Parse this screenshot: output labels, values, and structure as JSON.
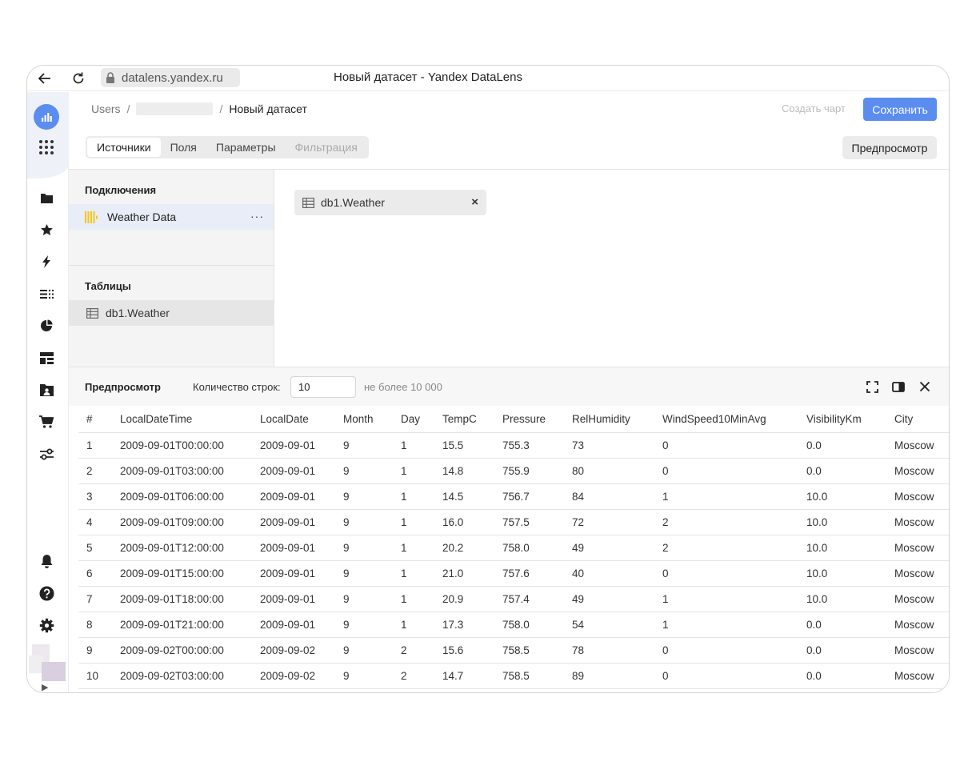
{
  "browser": {
    "url": "datalens.yandex.ru",
    "tab_title": "Новый датасет - Yandex DataLens"
  },
  "breadcrumb": {
    "root": "Users",
    "separator": "/",
    "current": "Новый датасет"
  },
  "header": {
    "create_chart_label": "Создать чарт",
    "save_label": "Сохранить",
    "preview_label": "Предпросмотр"
  },
  "tabs": [
    {
      "label": "Источники",
      "active": true
    },
    {
      "label": "Поля"
    },
    {
      "label": "Параметры"
    },
    {
      "label": "Фильтрация",
      "disabled": true
    }
  ],
  "sources": {
    "connections_title": "Подключения",
    "connection_name": "Weather Data",
    "more_label": "···",
    "tables_title": "Таблицы",
    "table_name": "db1.Weather"
  },
  "workspace": {
    "chip_label": "db1.Weather",
    "close_label": "×"
  },
  "preview": {
    "title": "Предпросмотр",
    "rows_label": "Количество строк:",
    "rows_value": "10",
    "rows_hint": "не более 10 000",
    "columns": [
      "#",
      "LocalDateTime",
      "LocalDate",
      "Month",
      "Day",
      "TempC",
      "Pressure",
      "RelHumidity",
      "WindSpeed10MinAvg",
      "VisibilityKm",
      "City"
    ],
    "rows": [
      [
        "1",
        "2009-09-01T00:00:00",
        "2009-09-01",
        "9",
        "1",
        "15.5",
        "755.3",
        "73",
        "0",
        "0.0",
        "Moscow"
      ],
      [
        "2",
        "2009-09-01T03:00:00",
        "2009-09-01",
        "9",
        "1",
        "14.8",
        "755.9",
        "80",
        "0",
        "0.0",
        "Moscow"
      ],
      [
        "3",
        "2009-09-01T06:00:00",
        "2009-09-01",
        "9",
        "1",
        "14.5",
        "756.7",
        "84",
        "1",
        "10.0",
        "Moscow"
      ],
      [
        "4",
        "2009-09-01T09:00:00",
        "2009-09-01",
        "9",
        "1",
        "16.0",
        "757.5",
        "72",
        "2",
        "10.0",
        "Moscow"
      ],
      [
        "5",
        "2009-09-01T12:00:00",
        "2009-09-01",
        "9",
        "1",
        "20.2",
        "758.0",
        "49",
        "2",
        "10.0",
        "Moscow"
      ],
      [
        "6",
        "2009-09-01T15:00:00",
        "2009-09-01",
        "9",
        "1",
        "21.0",
        "757.6",
        "40",
        "0",
        "10.0",
        "Moscow"
      ],
      [
        "7",
        "2009-09-01T18:00:00",
        "2009-09-01",
        "9",
        "1",
        "20.9",
        "757.4",
        "49",
        "1",
        "10.0",
        "Moscow"
      ],
      [
        "8",
        "2009-09-01T21:00:00",
        "2009-09-01",
        "9",
        "1",
        "17.3",
        "758.0",
        "54",
        "1",
        "0.0",
        "Moscow"
      ],
      [
        "9",
        "2009-09-02T00:00:00",
        "2009-09-02",
        "9",
        "2",
        "15.6",
        "758.5",
        "78",
        "0",
        "0.0",
        "Moscow"
      ],
      [
        "10",
        "2009-09-02T03:00:00",
        "2009-09-02",
        "9",
        "2",
        "14.7",
        "758.5",
        "89",
        "0",
        "0.0",
        "Moscow"
      ]
    ]
  },
  "nav": {
    "expand_label": "▶",
    "icons": [
      "logo-chart-icon",
      "apps-grid-icon",
      "folder-icon",
      "star-icon",
      "lightning-icon",
      "datasets-icon",
      "pie-chart-icon",
      "dashboard-icon",
      "user-folder-icon",
      "cart-icon",
      "settings-sliders-icon",
      "bell-icon",
      "help-icon",
      "gear-icon"
    ]
  },
  "colors": {
    "accent": "#5b8def",
    "connection_icon": "#f5c518",
    "selected_row": "#e8edf7",
    "nav_icon": "#222222"
  }
}
